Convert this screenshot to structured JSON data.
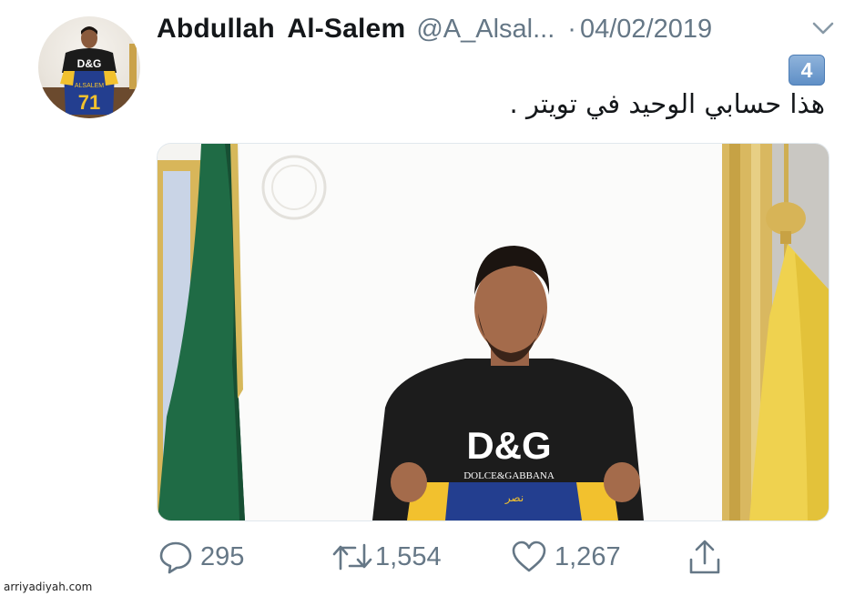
{
  "tweet": {
    "display_name": "Abdullah  Al-Salem",
    "handle": "@A_Alsal...",
    "separator": "·",
    "date": "04/02/2019",
    "badge": "4",
    "text": "هذا حسابي الوحيد في تويتر .",
    "avatar_shirt_text": "D&G",
    "avatar_jersey_name": "ALSALEM",
    "avatar_jersey_number": "71",
    "media": {
      "shirt_logo": "D&G",
      "shirt_subtitle": "DOLCE&GABBANA",
      "jersey_text": "نصر"
    }
  },
  "actions": {
    "reply_count": "295",
    "retweet_count": "1,554",
    "like_count": "1,267"
  },
  "icons": {
    "more": "chevron-down-icon",
    "reply": "reply-icon",
    "retweet": "retweet-icon",
    "like": "heart-icon",
    "share": "share-icon"
  },
  "colors": {
    "text": "#14171a",
    "muted": "#657786",
    "badge": "#6a97cb",
    "jersey_blue": "#233e8f",
    "jersey_yellow": "#f2c12e"
  },
  "watermark": "arriyadiyah.com"
}
